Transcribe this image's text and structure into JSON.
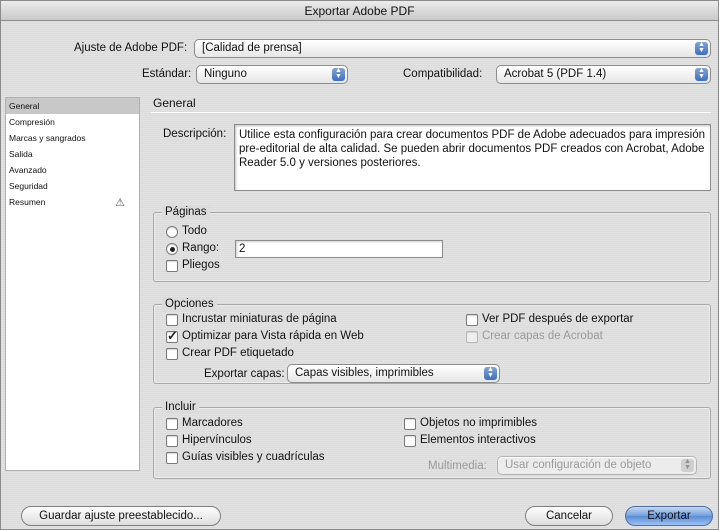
{
  "window": {
    "title": "Exportar Adobe PDF"
  },
  "header": {
    "preset_label": "Ajuste de Adobe PDF:",
    "preset_value": "[Calidad de prensa]",
    "standard_label": "Estándar:",
    "standard_value": "Ninguno",
    "compat_label": "Compatibilidad:",
    "compat_value": "Acrobat 5 (PDF 1.4)"
  },
  "sidebar": {
    "items": [
      {
        "label": "General"
      },
      {
        "label": "Compresión"
      },
      {
        "label": "Marcas y sangrados"
      },
      {
        "label": "Salida"
      },
      {
        "label": "Avanzado"
      },
      {
        "label": "Seguridad"
      },
      {
        "label": "Resumen"
      }
    ],
    "warning_glyph": "⚠"
  },
  "main": {
    "section_title": "General",
    "description_label": "Descripción:",
    "description_text": "Utilice esta configuración para crear documentos PDF de Adobe adecuados para impresión pre-editorial de alta calidad. Se pueden abrir documentos PDF creados con Acrobat, Adobe Reader 5.0 y versiones posteriores.",
    "pages": {
      "title": "Páginas",
      "all_label": "Todo",
      "range_label": "Rango:",
      "range_value": "2",
      "spreads_label": "Pliegos"
    },
    "options": {
      "title": "Opciones",
      "embed_thumbs": "Incrustar miniaturas de página",
      "optimize_web": "Optimizar para Vista rápida en Web",
      "tagged_pdf": "Crear PDF etiquetado",
      "view_after": "Ver PDF después de exportar",
      "acrobat_layers": "Crear capas de Acrobat",
      "export_layers_label": "Exportar capas:",
      "export_layers_value": "Capas visibles, imprimibles"
    },
    "include": {
      "title": "Incluir",
      "bookmarks": "Marcadores",
      "hyperlinks": "Hipervínculos",
      "guides": "Guías visibles y cuadrículas",
      "non_printing": "Objetos no imprimibles",
      "interactive": "Elementos interactivos",
      "multimedia_label": "Multimedia:",
      "multimedia_value": "Usar configuración de objeto"
    }
  },
  "footer": {
    "save_preset": "Guardar ajuste preestablecido...",
    "cancel": "Cancelar",
    "export": "Exportar"
  },
  "colors": {
    "accent": "#5a8bd6",
    "window_bg": "#dcdcdc"
  }
}
